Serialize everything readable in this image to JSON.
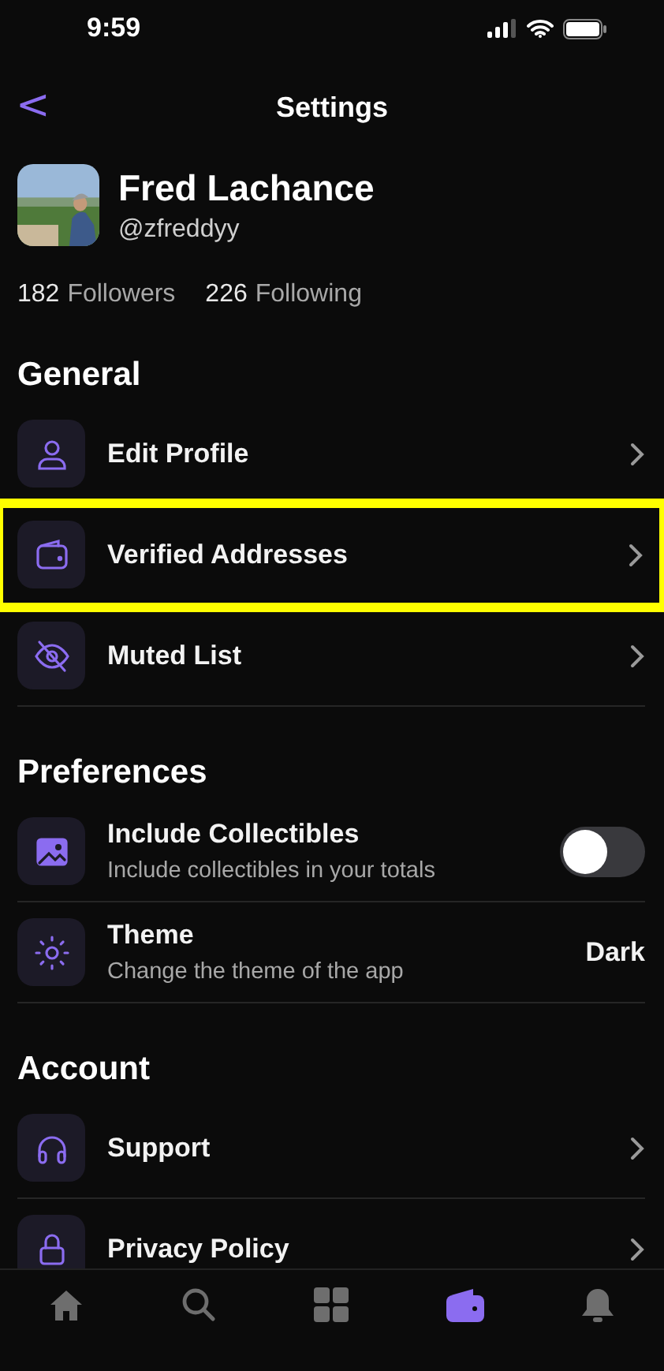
{
  "status_bar": {
    "time": "9:59"
  },
  "nav": {
    "back": "<",
    "title": "Settings"
  },
  "profile": {
    "name": "Fred Lachance",
    "handle": "@zfreddyy",
    "followers_count": "182",
    "followers_label": "Followers",
    "following_count": "226",
    "following_label": "Following"
  },
  "sections": [
    {
      "title": "General",
      "items": [
        {
          "kind": "link",
          "label": "Edit Profile",
          "highlighted": false
        },
        {
          "kind": "link",
          "label": "Verified Addresses",
          "highlighted": true
        },
        {
          "kind": "link",
          "label": "Muted List",
          "highlighted": false
        }
      ]
    },
    {
      "title": "Preferences",
      "items": [
        {
          "kind": "toggle",
          "label": "Include Collectibles",
          "subtitle": "Include collectibles in your totals",
          "on": false,
          "highlighted": false
        },
        {
          "kind": "value",
          "label": "Theme",
          "subtitle": "Change the theme of the app",
          "value": "Dark",
          "highlighted": false
        }
      ]
    },
    {
      "title": "Account",
      "items": [
        {
          "kind": "link",
          "label": "Support",
          "highlighted": false
        },
        {
          "kind": "link",
          "label": "Privacy Policy",
          "highlighted": false
        }
      ]
    }
  ],
  "tab_bar": [
    {
      "selected": false
    },
    {
      "selected": false
    },
    {
      "selected": false
    },
    {
      "selected": true
    },
    {
      "selected": false
    }
  ]
}
